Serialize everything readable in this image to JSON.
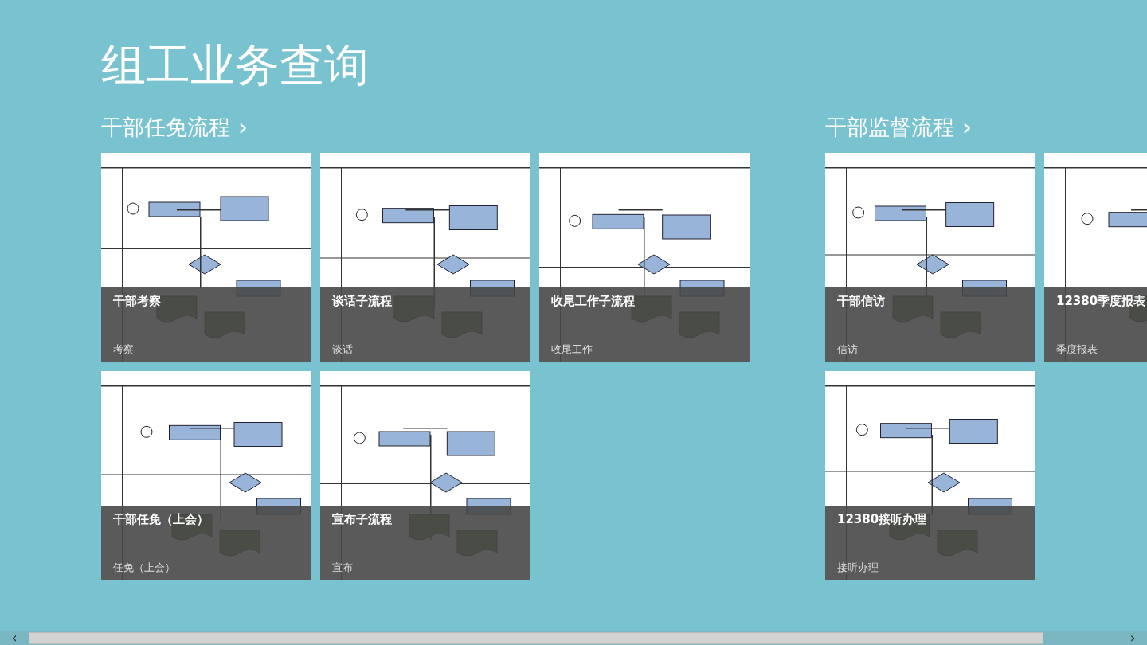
{
  "page_title": "组工业务查询",
  "groups": [
    {
      "title": "干部任免流程",
      "chevron": "›",
      "tiles": [
        {
          "title": "干部考察",
          "subtitle": "考察",
          "kind": "picture"
        },
        {
          "title": "谈话子流程",
          "subtitle": "谈话",
          "kind": "picture"
        },
        {
          "title": "收尾工作子流程",
          "subtitle": "收尾工作",
          "kind": "picture"
        },
        {
          "title": "干部任免（上会）",
          "subtitle": "任免（上会）",
          "kind": "picture"
        },
        {
          "title": "宣布子流程",
          "subtitle": "宣布",
          "kind": "picture"
        }
      ]
    },
    {
      "title": "干部监督流程",
      "chevron": "›",
      "tiles": [
        {
          "title": "干部信访",
          "subtitle": "信访",
          "kind": "picture"
        },
        {
          "title": "12380季度报表",
          "subtitle": "季度报表",
          "kind": "picture"
        },
        {
          "title": "12380接听办理",
          "subtitle": "接听办理",
          "kind": "picture"
        }
      ]
    }
  ],
  "scrollbar": {
    "left": "‹",
    "right": "›"
  }
}
